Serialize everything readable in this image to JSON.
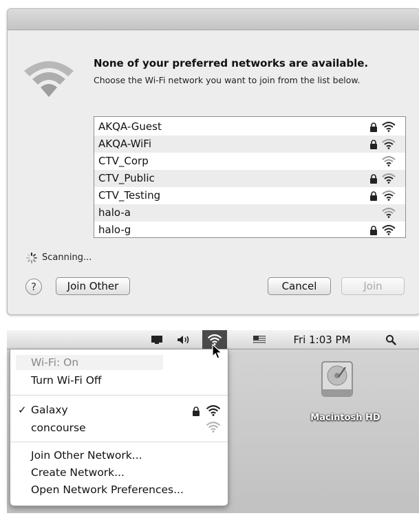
{
  "dialog": {
    "heading": "None of your preferred networks are available.",
    "subtext": "Choose the Wi-Fi network you want to join from the list below.",
    "networks": [
      {
        "name": "AKQA-Guest",
        "locked": true,
        "icon": "wifi-signal-icon"
      },
      {
        "name": "AKQA-WiFi",
        "locked": true,
        "icon": "wifi-signal-icon"
      },
      {
        "name": "CTV_Corp",
        "locked": false,
        "icon": "wifi-signal-icon"
      },
      {
        "name": "CTV_Public",
        "locked": true,
        "icon": "wifi-signal-icon"
      },
      {
        "name": "CTV_Testing",
        "locked": true,
        "icon": "wifi-signal-icon"
      },
      {
        "name": "halo-a",
        "locked": false,
        "icon": "wifi-signal-icon"
      },
      {
        "name": "halo-g",
        "locked": true,
        "icon": "wifi-signal-icon"
      }
    ],
    "scanning_label": "Scanning...",
    "help_label": "?",
    "join_other_label": "Join Other",
    "cancel_label": "Cancel",
    "join_label": "Join"
  },
  "menubar": {
    "clock": "Fri 1:03 PM",
    "icons": [
      "display-icon",
      "volume-icon",
      "wifi-icon",
      "us-flag-icon",
      "spotlight-search-icon"
    ]
  },
  "wifi_menu": {
    "status": "Wi-Fi: On",
    "toggle": "Turn Wi-Fi Off",
    "check_mark": "✓",
    "networks": [
      {
        "name": "Galaxy",
        "selected": true,
        "locked": true
      },
      {
        "name": "concourse",
        "selected": false,
        "locked": false
      }
    ],
    "join_other": "Join Other Network...",
    "create": "Create Network...",
    "preferences": "Open Network Preferences..."
  },
  "desktop": {
    "disk_label": "Macintosh HD"
  },
  "colors": {
    "dialog_bg": "#ededed",
    "menu_highlight": "#4a4a4a",
    "desktop_bg": "#c9c9c9"
  }
}
